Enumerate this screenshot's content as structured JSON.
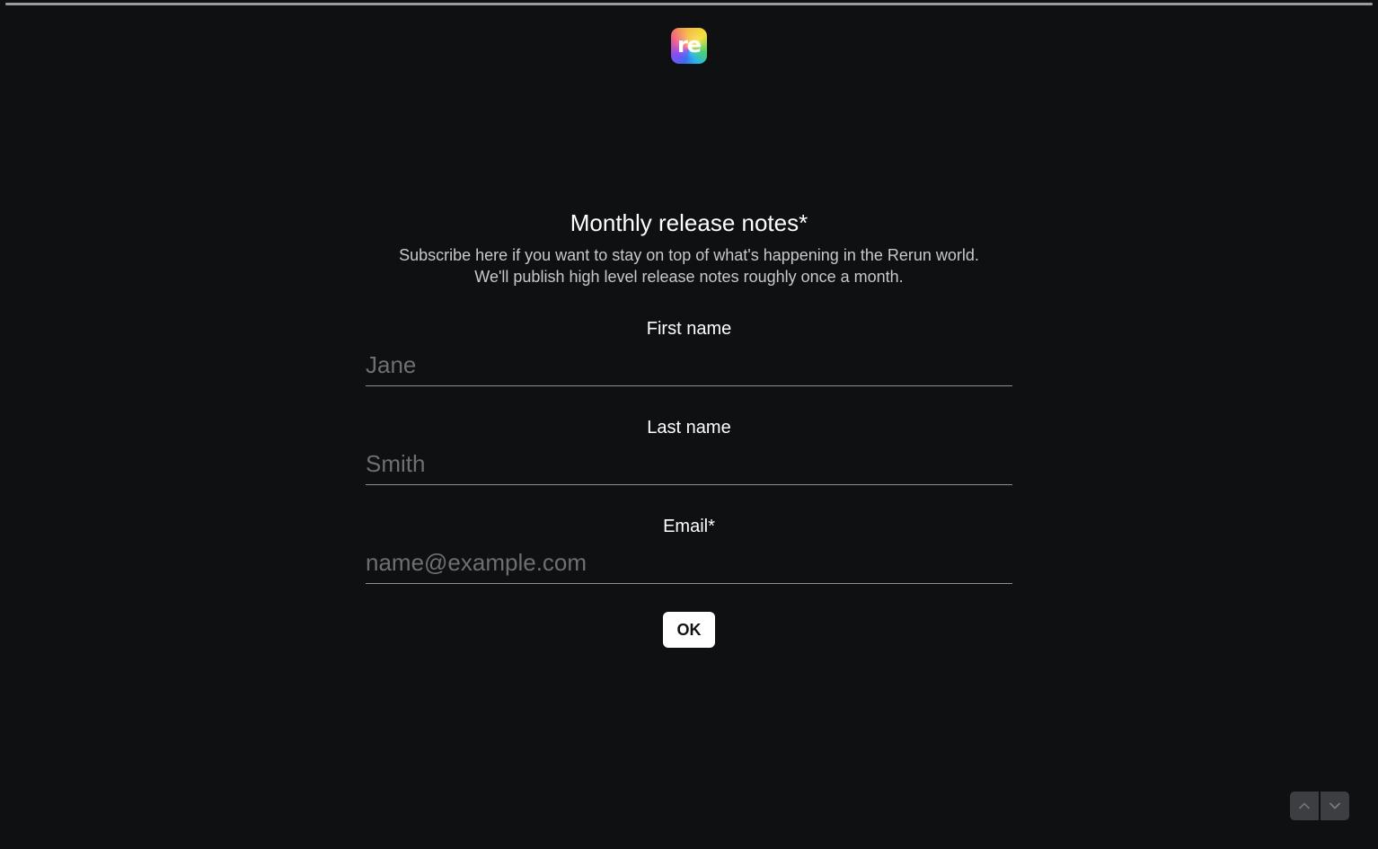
{
  "progress": {
    "fraction": 1.0
  },
  "logo": {
    "text": "re"
  },
  "form": {
    "title": "Monthly release notes",
    "required_mark": "*",
    "subtitle_line1": "Subscribe here if you want to stay on top of what's happening in the Rerun world.",
    "subtitle_line2": "We'll publish high level release notes roughly once a month.",
    "fields": [
      {
        "label": "First name",
        "required": "",
        "placeholder": "Jane",
        "value": ""
      },
      {
        "label": "Last name",
        "required": "",
        "placeholder": "Smith",
        "value": ""
      },
      {
        "label": "Email",
        "required": "*",
        "placeholder": "name@example.com",
        "value": ""
      }
    ],
    "submit_label": "OK"
  },
  "navigation": {
    "up_icon": "chevron-up-icon",
    "down_icon": "chevron-down-icon"
  },
  "colors": {
    "background": "#0f1012",
    "button_background": "#ffffff",
    "nav_button_background": "#3d3e41"
  }
}
